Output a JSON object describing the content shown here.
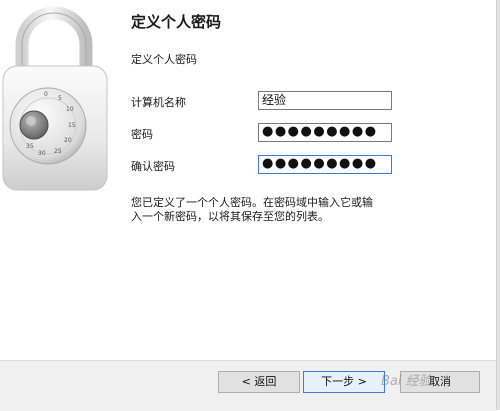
{
  "header": {
    "title": "定义个人密码",
    "subtitle": "定义个人密码"
  },
  "form": {
    "computer_name_label": "计算机名称",
    "computer_name_value": "经验",
    "password_label": "密码",
    "password_value": "●●●●●●●●●",
    "confirm_label": "确认密码",
    "confirm_value": "●●●●●●●●●"
  },
  "description": {
    "line1": "您已定义了一个个人密码。在密码域中输入它或输",
    "line2": "入一个新密码，以将其保存至您的列表。"
  },
  "buttons": {
    "back": "< 返回",
    "next": "下一步 >",
    "cancel": "取消"
  },
  "watermark": "Bai 经验",
  "colors": {
    "focus_border": "#3d7bd6",
    "footer_bg": "#f0f0f0"
  },
  "icons": {
    "illustration": "padlock-icon"
  }
}
